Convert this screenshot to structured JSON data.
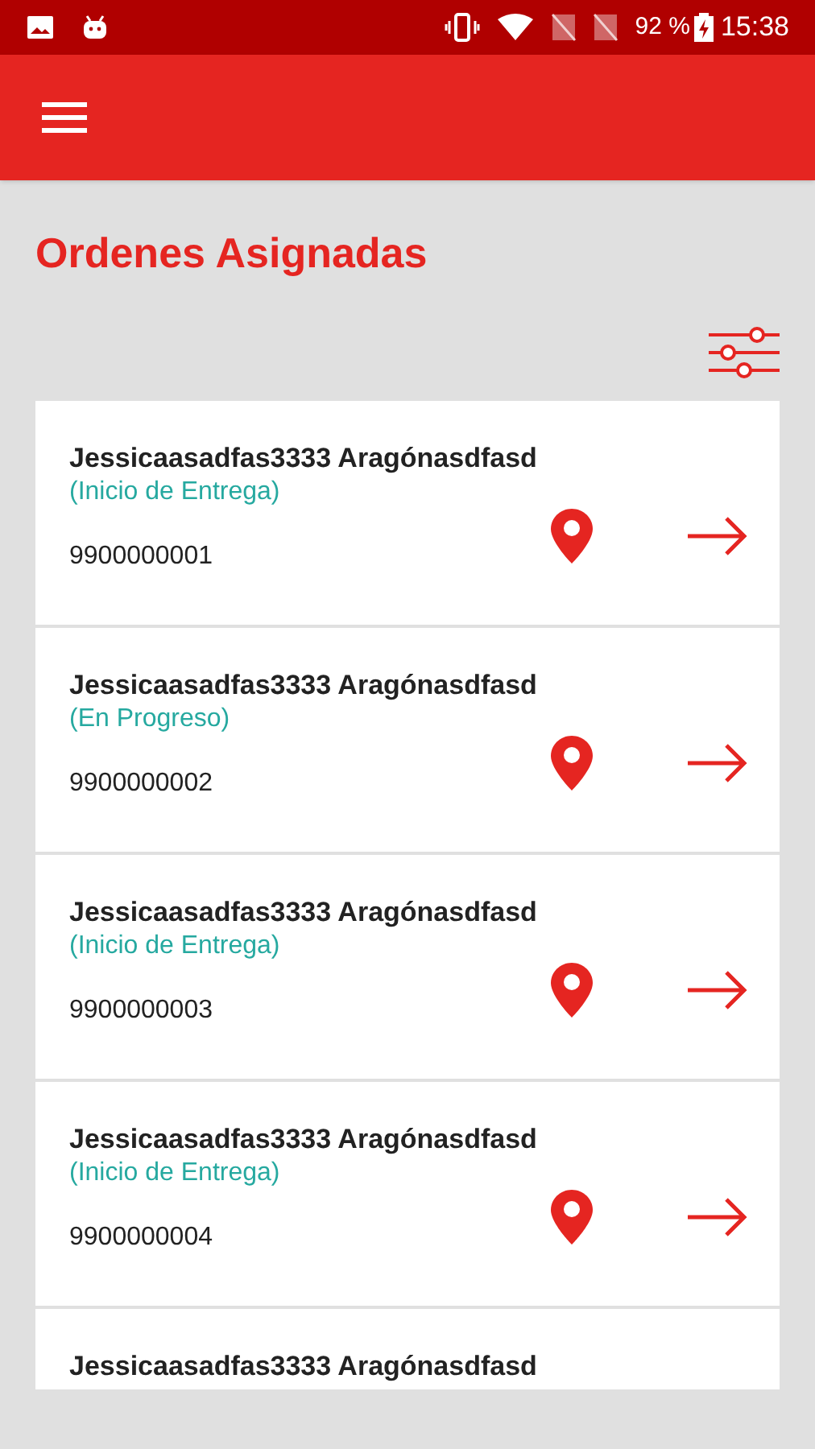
{
  "status_bar": {
    "battery": "92 %",
    "time": "15:38"
  },
  "screen": {
    "title": "Ordenes Asignadas"
  },
  "orders": [
    {
      "name": "Jessicaasadfas3333 Aragónasdfasd",
      "status": "(Inicio de Entrega)",
      "number": "9900000001"
    },
    {
      "name": "Jessicaasadfas3333 Aragónasdfasd",
      "status": "(En Progreso)",
      "number": "9900000002"
    },
    {
      "name": "Jessicaasadfas3333 Aragónasdfasd",
      "status": "(Inicio de Entrega)",
      "number": "9900000003"
    },
    {
      "name": "Jessicaasadfas3333 Aragónasdfasd",
      "status": "(Inicio de Entrega)",
      "number": "9900000004"
    },
    {
      "name": "Jessicaasadfas3333 Aragónasdfasd"
    }
  ]
}
